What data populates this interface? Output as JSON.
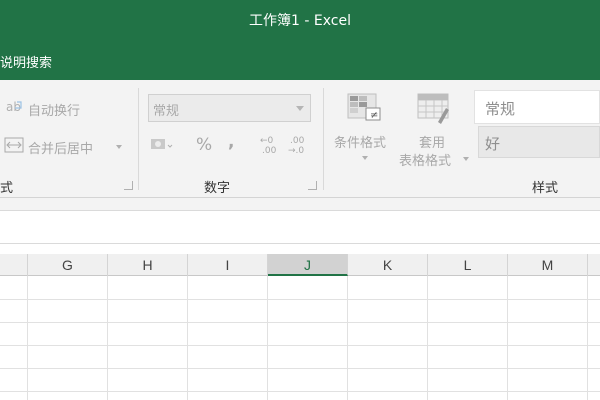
{
  "window": {
    "title": "工作簿1  -  Excel"
  },
  "tell_me": {
    "label": "说明搜索"
  },
  "ribbon": {
    "alignment": {
      "wrap_text": "自动换行",
      "merge_center": "合并后居中",
      "group_label": "式"
    },
    "number": {
      "format_value": "常规",
      "percent": "%",
      "comma": ",",
      "increase_decimal_top": "←0",
      "increase_decimal_bottom": ".00",
      "decrease_decimal_top": ".00",
      "decrease_decimal_bottom": "→.0",
      "group_label": "数字"
    },
    "styles": {
      "conditional_formatting": "条件格式",
      "format_as_table_line1": "套用",
      "format_as_table_line2": "表格格式",
      "style_normal": "常规",
      "style_good": "好",
      "group_label": "样式"
    }
  },
  "sheet": {
    "columns": [
      "G",
      "H",
      "I",
      "J",
      "K",
      "L",
      "M"
    ],
    "selected_column": "J"
  },
  "colors": {
    "accent": "#217346"
  }
}
